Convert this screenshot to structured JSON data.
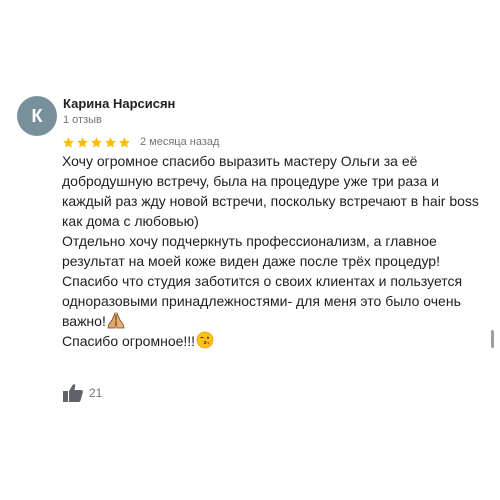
{
  "review": {
    "author": {
      "initial": "К",
      "name": "Карина Нарсисян",
      "reviews_count": "1 отзыв",
      "avatar_color": "#78909c"
    },
    "rating": 5,
    "star_color": "#fbbc04",
    "date": "2 месяца назад",
    "paragraphs": [
      "Хочу огромное спасибо выразить мастеру Ольги за её добродушную встречу, была на процедуре уже три раза и каждый раз жду новой встречи, поскольку встречают в hair boss как дома с любовью)",
      "Отдельно хочу подчеркнуть профессионализм, а главное результат на моей коже виден даже после трёх процедур!",
      "Спасибо что студия заботится о своих клиентах и пользуется одноразовыми принадлежностями- для меня это было очень важно!",
      "Спасибо огромное!!!"
    ],
    "emojis": [
      "folded-hands",
      "face-blowing-kiss"
    ],
    "likes": "21",
    "like_icon": "thumbs-up-icon"
  }
}
